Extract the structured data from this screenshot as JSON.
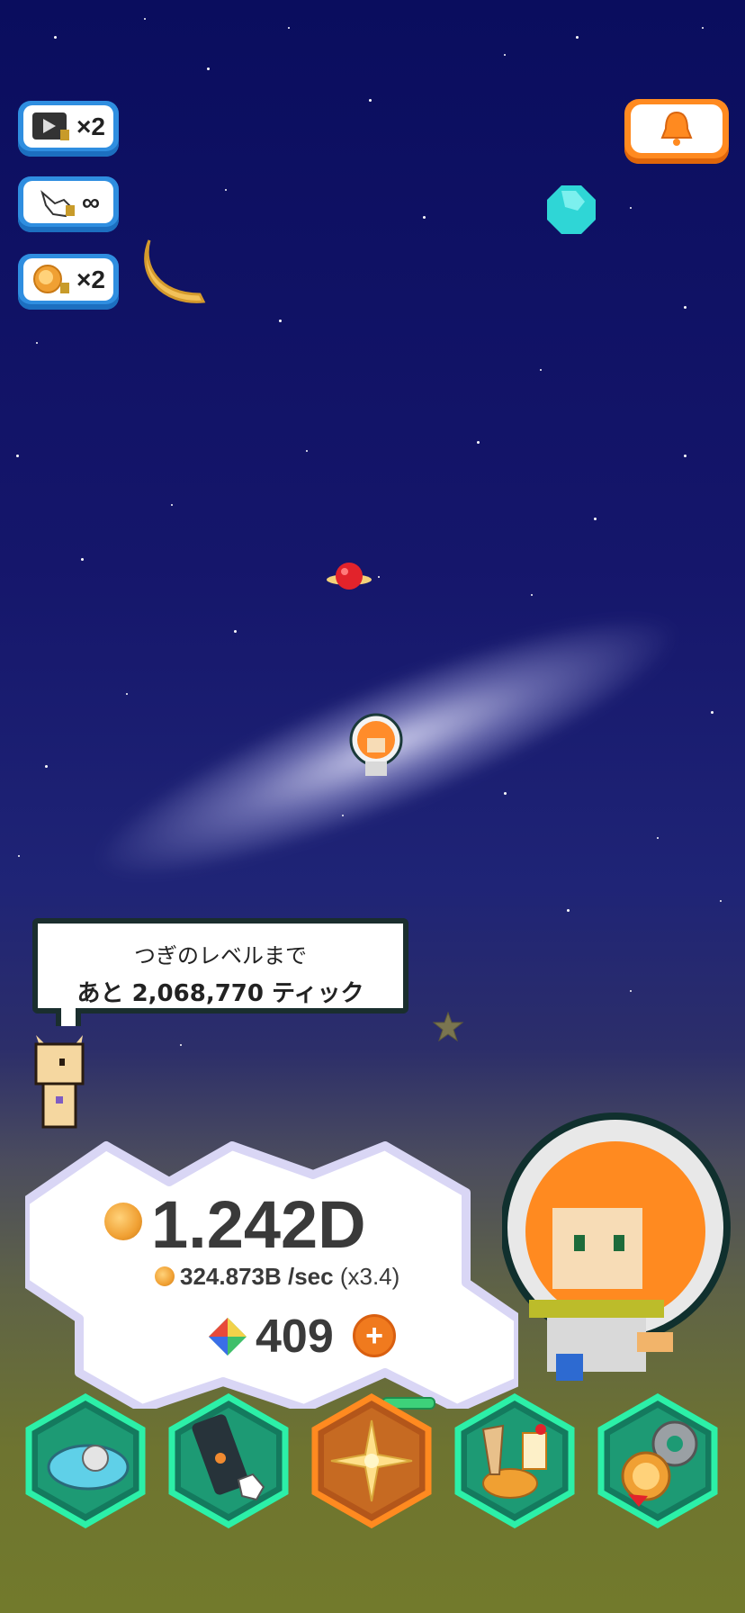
{
  "boosts": [
    {
      "icon": "video-ad-icon",
      "value": "×2"
    },
    {
      "icon": "tap-hand-icon",
      "value": "∞"
    },
    {
      "icon": "coin-boost-icon",
      "value": "×2"
    }
  ],
  "notifications": {
    "icon": "bell-icon"
  },
  "speech_bubble": {
    "line1": "つぎのレベルまで",
    "line2": "あと 2,068,770 ティック"
  },
  "currency": {
    "total": "1.242D",
    "rate": "324.873B /sec",
    "multiplier": "(x3.4)",
    "gems": "409"
  },
  "nav": [
    {
      "icon": "spaceship-icon",
      "name": "ship"
    },
    {
      "icon": "phone-tap-icon",
      "name": "tap"
    },
    {
      "icon": "star-burst-icon",
      "name": "star",
      "active": true
    },
    {
      "icon": "food-icon",
      "name": "food"
    },
    {
      "icon": "settings-medal-icon",
      "name": "settings"
    }
  ],
  "colors": {
    "sky_top": "#0a0d5e",
    "sky_bottom": "#727a2c",
    "nav_glow": "#2cf0a8",
    "nav_active": "#ff8a20",
    "boost_border": "#2f8ee0"
  }
}
